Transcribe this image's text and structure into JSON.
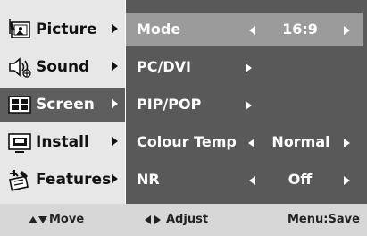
{
  "menu": {
    "items": [
      {
        "label": "Picture",
        "icon": "picture-icon",
        "selected": false
      },
      {
        "label": "Sound",
        "icon": "sound-icon",
        "selected": false
      },
      {
        "label": "Screen",
        "icon": "screen-icon",
        "selected": true
      },
      {
        "label": "Install",
        "icon": "install-icon",
        "selected": false
      },
      {
        "label": "Features",
        "icon": "features-icon",
        "selected": false
      }
    ]
  },
  "submenu": {
    "rows": [
      {
        "label": "Mode",
        "value": "16:9",
        "highlighted": true
      },
      {
        "label": "PC/DVI",
        "value": ""
      },
      {
        "label": "PIP/POP",
        "value": ""
      },
      {
        "label": "Colour Temp",
        "value": "Normal"
      },
      {
        "label": "NR",
        "value": "Off"
      }
    ]
  },
  "footer": {
    "move": "Move",
    "adjust": "Adjust",
    "save": "Menu:Save"
  },
  "colors": {
    "left_panel_bg": "#e7e7e7",
    "selected_item_bg": "#5e5e5e",
    "right_panel_bg": "#595959",
    "highlight_row_bg": "#9b9b9b",
    "footer_bg": "#d7d7d7"
  }
}
